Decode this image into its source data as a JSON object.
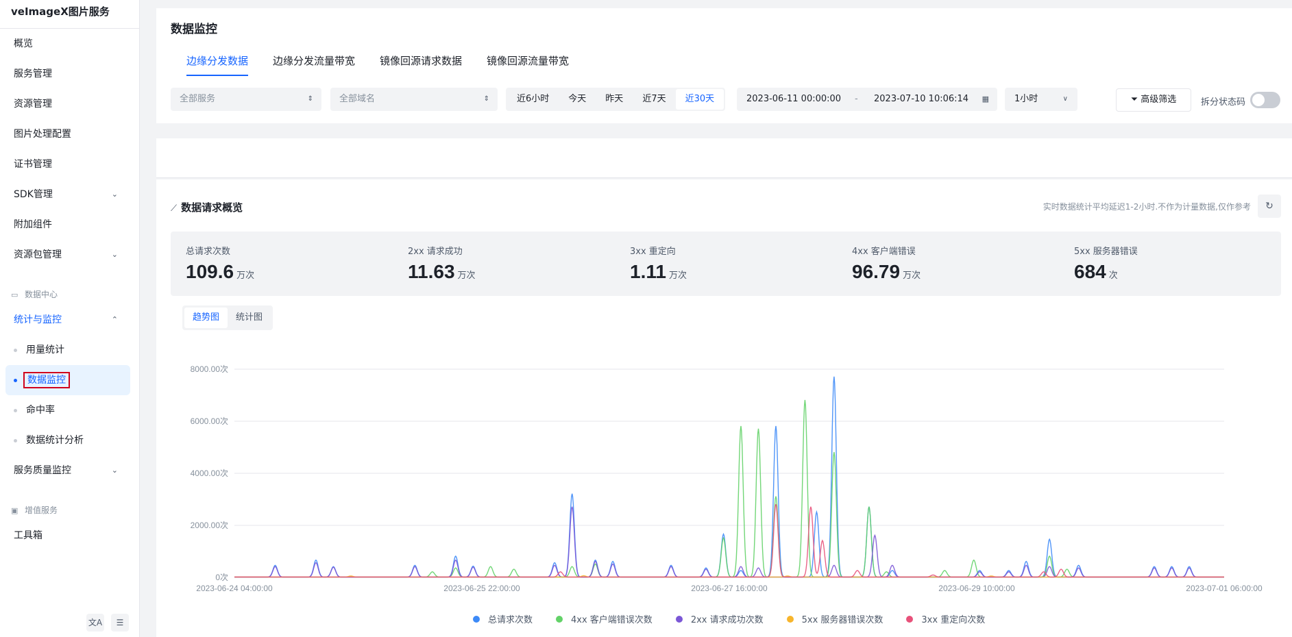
{
  "app": {
    "title": "veImageX图片服务"
  },
  "sidebar": {
    "items": [
      {
        "label": "概览",
        "chevron": ""
      },
      {
        "label": "服务管理",
        "chevron": ""
      },
      {
        "label": "资源管理",
        "chevron": ""
      },
      {
        "label": "图片处理配置",
        "chevron": ""
      },
      {
        "label": "证书管理",
        "chevron": ""
      },
      {
        "label": "SDK管理",
        "chevron": "⌄"
      },
      {
        "label": "附加组件",
        "chevron": ""
      },
      {
        "label": "资源包管理",
        "chevron": "⌄"
      }
    ],
    "group_data": "数据中心",
    "stats_monitor": {
      "label": "统计与监控",
      "chevron": "⌃"
    },
    "sub_items": [
      {
        "label": "用量统计"
      },
      {
        "label": "数据监控"
      },
      {
        "label": "命中率"
      },
      {
        "label": "数据统计分析"
      }
    ],
    "service_quality": {
      "label": "服务质量监控",
      "chevron": "⌄"
    },
    "group_value": "增值服务",
    "toolbox": "工具箱",
    "bottom_icons": [
      "translate-icon",
      "collapse-icon"
    ]
  },
  "header": {
    "title": "数据监控",
    "tabs": [
      "边缘分发数据",
      "边缘分发流量带宽",
      "镜像回源请求数据",
      "镜像回源流量带宽"
    ]
  },
  "filters": {
    "service_placeholder": "全部服务",
    "domain_placeholder": "全部域名",
    "quick_ranges": [
      "近6小时",
      "今天",
      "昨天",
      "近7天",
      "近30天"
    ],
    "quick_selected": "近30天",
    "start": "2023-06-11 00:00:00",
    "separator": "-",
    "end": "2023-07-10 10:06:14",
    "granularity": "1小时",
    "advanced": "高级筛选",
    "split_label": "拆分状态码",
    "split_on": false
  },
  "overview": {
    "title": "数据请求概览",
    "note": "实时数据统计平均延迟1-2小时.不作为计量数据,仅作参考",
    "stats": [
      {
        "label": "总请求次数",
        "value": "109.6",
        "unit": "万次"
      },
      {
        "label": "2xx 请求成功",
        "value": "11.63",
        "unit": "万次"
      },
      {
        "label": "3xx 重定向",
        "value": "1.11",
        "unit": "万次"
      },
      {
        "label": "4xx 客户端错误",
        "value": "96.79",
        "unit": "万次"
      },
      {
        "label": "5xx 服务器错误",
        "value": "684",
        "unit": "次"
      }
    ],
    "view_tabs": [
      "趋势图",
      "统计图"
    ],
    "view_selected": "趋势图"
  },
  "chart_data": {
    "type": "line",
    "ylim": [
      0,
      8000
    ],
    "yticks": [
      "0次",
      "2000.00次",
      "4000.00次",
      "6000.00次",
      "8000.00次"
    ],
    "xticks": [
      "2023-06-24 04:00:00",
      "2023-06-25 22:00:00",
      "2023-06-27 16:00:00",
      "2023-06-29 10:00:00",
      "2023-07-01 06:00:00"
    ],
    "x_range_hours": [
      0,
      170
    ],
    "series": [
      {
        "name": "总请求次数",
        "color": "#3d8af7",
        "peaks": [
          [
            7,
            450
          ],
          [
            14,
            650
          ],
          [
            17,
            400
          ],
          [
            31,
            450
          ],
          [
            38,
            800
          ],
          [
            41,
            420
          ],
          [
            55,
            550
          ],
          [
            58,
            3200
          ],
          [
            62,
            650
          ],
          [
            65,
            600
          ],
          [
            75,
            450
          ],
          [
            81,
            350
          ],
          [
            84,
            1650
          ],
          [
            87,
            250
          ],
          [
            93,
            5800
          ],
          [
            100,
            2500
          ],
          [
            103,
            7700
          ],
          [
            109,
            2700
          ],
          [
            113,
            250
          ],
          [
            128,
            250
          ],
          [
            133,
            250
          ],
          [
            136,
            600
          ],
          [
            140,
            1450
          ],
          [
            145,
            450
          ],
          [
            158,
            400
          ],
          [
            161,
            400
          ],
          [
            164,
            400
          ]
        ]
      },
      {
        "name": "4xx 客户端错误次数",
        "color": "#63d268",
        "peaks": [
          [
            34,
            200
          ],
          [
            38,
            350
          ],
          [
            44,
            400
          ],
          [
            48,
            300
          ],
          [
            58,
            400
          ],
          [
            62,
            500
          ],
          [
            84,
            1500
          ],
          [
            87,
            5800
          ],
          [
            90,
            5700
          ],
          [
            93,
            3100
          ],
          [
            98,
            6800
          ],
          [
            103,
            4800
          ],
          [
            109,
            2700
          ],
          [
            112,
            200
          ],
          [
            122,
            250
          ],
          [
            127,
            650
          ],
          [
            140,
            800
          ],
          [
            143,
            300
          ]
        ]
      },
      {
        "name": "2xx 请求成功次数",
        "color": "#7b57d6",
        "peaks": [
          [
            7,
            400
          ],
          [
            14,
            550
          ],
          [
            17,
            380
          ],
          [
            31,
            400
          ],
          [
            38,
            650
          ],
          [
            41,
            380
          ],
          [
            55,
            450
          ],
          [
            58,
            2700
          ],
          [
            62,
            600
          ],
          [
            65,
            500
          ],
          [
            75,
            400
          ],
          [
            81,
            300
          ],
          [
            87,
            400
          ],
          [
            90,
            350
          ],
          [
            103,
            450
          ],
          [
            110,
            1600
          ],
          [
            113,
            450
          ],
          [
            128,
            200
          ],
          [
            133,
            200
          ],
          [
            136,
            450
          ],
          [
            140,
            400
          ],
          [
            145,
            350
          ],
          [
            158,
            350
          ],
          [
            161,
            350
          ],
          [
            164,
            350
          ]
        ]
      },
      {
        "name": "5xx 服务器错误次数",
        "color": "#f7b52c",
        "peaks": [
          [
            20,
            40
          ],
          [
            60,
            50
          ],
          [
            95,
            40
          ],
          [
            130,
            40
          ]
        ]
      },
      {
        "name": "3xx 重定向次数",
        "color": "#e8517a",
        "peaks": [
          [
            56,
            200
          ],
          [
            93,
            2800
          ],
          [
            99,
            2700
          ],
          [
            101,
            1400
          ],
          [
            107,
            250
          ],
          [
            120,
            80
          ],
          [
            139,
            200
          ],
          [
            142,
            300
          ]
        ]
      }
    ]
  }
}
